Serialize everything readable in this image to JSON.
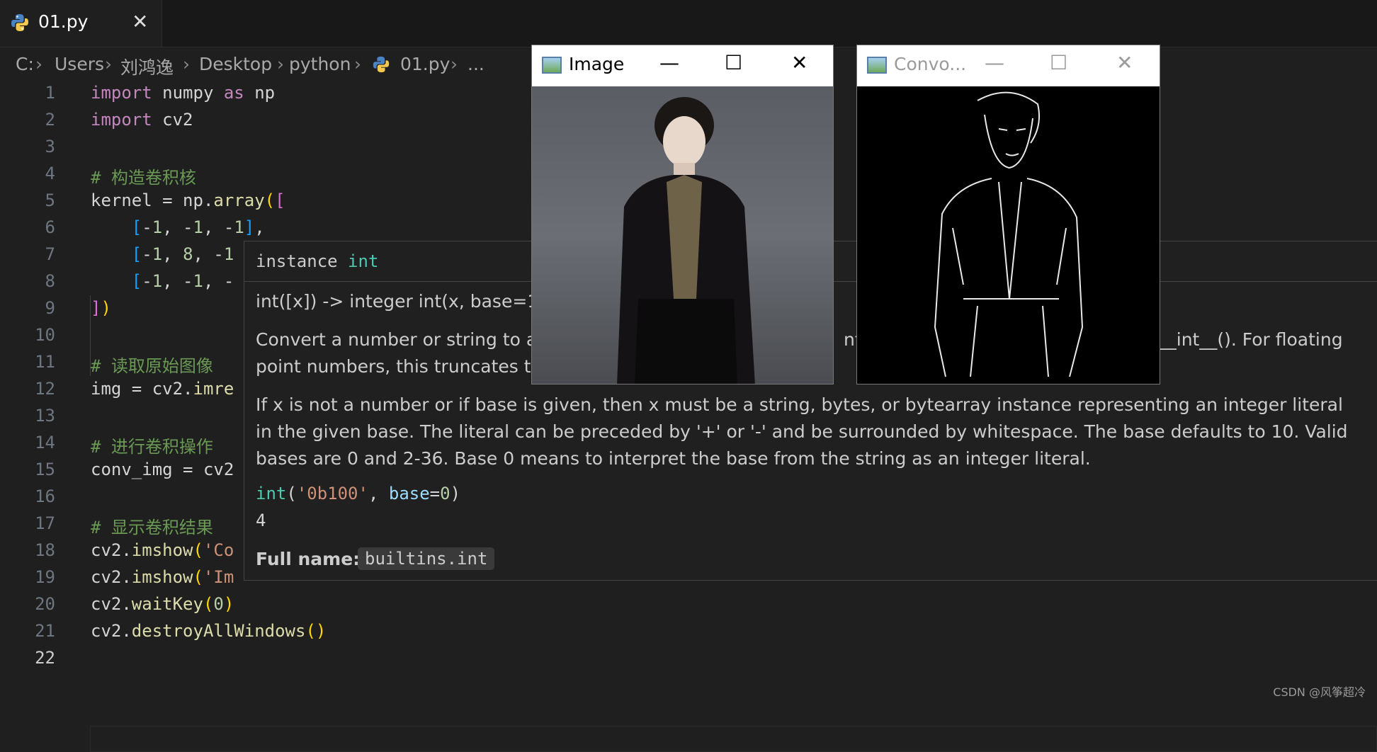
{
  "tab": {
    "filename": "01.py",
    "close_glyph": "✕"
  },
  "breadcrumb": [
    "C:",
    "Users",
    "刘鸿逸",
    "Desktop",
    "python",
    "01.py",
    "..."
  ],
  "code": {
    "line_numbers": [
      "1",
      "2",
      "3",
      "4",
      "5",
      "6",
      "7",
      "8",
      "9",
      "10",
      "11",
      "12",
      "13",
      "14",
      "15",
      "16",
      "17",
      "18",
      "19",
      "20",
      "21",
      "22"
    ],
    "active_line": "22"
  },
  "hover": {
    "signature_prefix": "instance",
    "signature_type": "int",
    "call_signature": "int([x]) -> integer int(x, base=10",
    "para1_a": "Convert a number or string to a",
    "para1_b": "nts",
    "para1_c": "x.__int__(). For floating",
    "para1_d": "point numbers, this truncates to",
    "para2": "If x is not a number or if base is given, then x must be a string, bytes, or bytearray instance representing an integer literal in the given base. The literal can be preceded by '+' or '-' and be surrounded by whitespace. The base defaults to 10. Valid bases are 0 and 2-36. Base 0 means to interpret the base from the string as an integer literal.",
    "example_result": "4",
    "fullname_label": "Full name:",
    "fullname_value": "builtins.int"
  },
  "windows": [
    {
      "title": "Image",
      "active": true,
      "min": "—",
      "max": "☐",
      "close": "✕"
    },
    {
      "title": "Convo...",
      "active": false,
      "min": "—",
      "max": "☐",
      "close": "✕"
    }
  ],
  "watermark": "CSDN @风筝超冷"
}
